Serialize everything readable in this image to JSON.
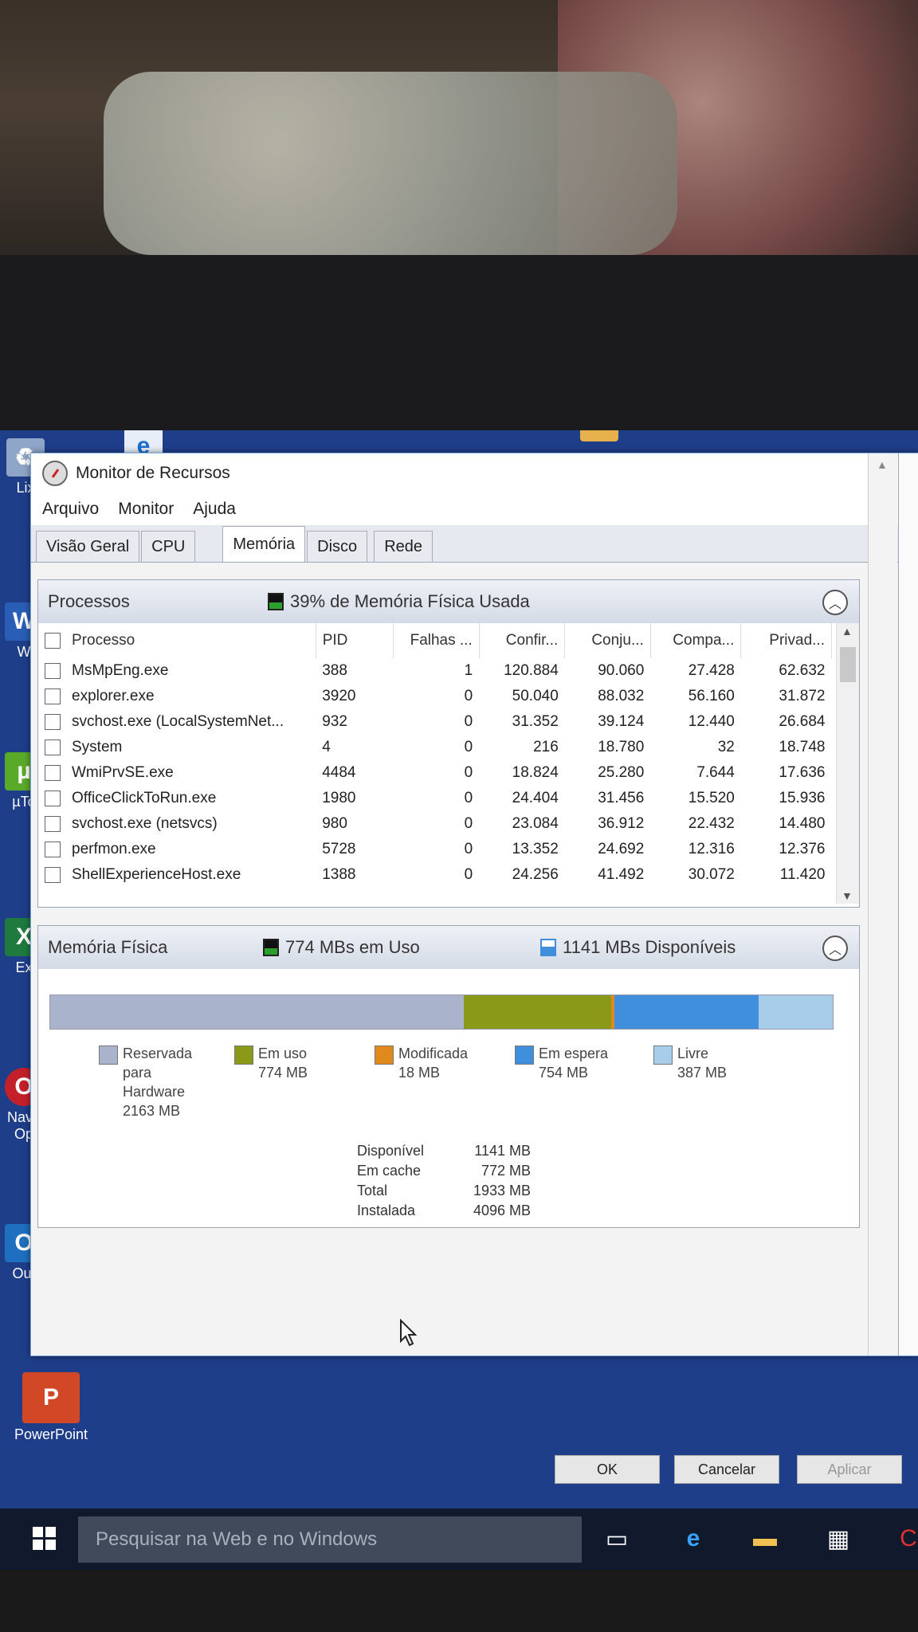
{
  "window": {
    "title": "Monitor de Recursos",
    "menu": [
      "Arquivo",
      "Monitor",
      "Ajuda"
    ],
    "tabs": [
      "Visão Geral",
      "CPU",
      "Memória",
      "Disco",
      "Rede"
    ],
    "active_tab": "Memória"
  },
  "processes": {
    "title": "Processos",
    "usage_text": "39% de Memória Física Usada",
    "columns": [
      "Processo",
      "PID",
      "Falhas ...",
      "Confir...",
      "Conju...",
      "Compa...",
      "Privad..."
    ],
    "rows": [
      [
        "MsMpEng.exe",
        "388",
        "1",
        "120.884",
        "90.060",
        "27.428",
        "62.632"
      ],
      [
        "explorer.exe",
        "3920",
        "0",
        "50.040",
        "88.032",
        "56.160",
        "31.872"
      ],
      [
        "svchost.exe (LocalSystemNet...",
        "932",
        "0",
        "31.352",
        "39.124",
        "12.440",
        "26.684"
      ],
      [
        "System",
        "4",
        "0",
        "216",
        "18.780",
        "32",
        "18.748"
      ],
      [
        "WmiPrvSE.exe",
        "4484",
        "0",
        "18.824",
        "25.280",
        "7.644",
        "17.636"
      ],
      [
        "OfficeClickToRun.exe",
        "1980",
        "0",
        "24.404",
        "31.456",
        "15.520",
        "15.936"
      ],
      [
        "svchost.exe (netsvcs)",
        "980",
        "0",
        "23.084",
        "36.912",
        "22.432",
        "14.480"
      ],
      [
        "perfmon.exe",
        "5728",
        "0",
        "13.352",
        "24.692",
        "12.316",
        "12.376"
      ],
      [
        "ShellExperienceHost.exe",
        "1388",
        "0",
        "24.256",
        "41.492",
        "30.072",
        "11.420"
      ]
    ]
  },
  "memory": {
    "title": "Memória Física",
    "in_use_text": "774 MBs em Uso",
    "available_text": "1141 MBs Disponíveis",
    "segments": [
      {
        "label": "Reservada para Hardware",
        "value": "2163 MB",
        "mb": 2163,
        "color": "#a9b4cc"
      },
      {
        "label": "Em uso",
        "value": "774 MB",
        "mb": 774,
        "color": "#8a9a18"
      },
      {
        "label": "Modificada",
        "value": "18 MB",
        "mb": 18,
        "color": "#e08a1e"
      },
      {
        "label": "Em espera",
        "value": "754 MB",
        "mb": 754,
        "color": "#3f8fdc"
      },
      {
        "label": "Livre",
        "value": "387 MB",
        "mb": 387,
        "color": "#a7cdea"
      }
    ],
    "summary": [
      {
        "label": "Disponível",
        "value": "1141 MB"
      },
      {
        "label": "Em cache",
        "value": "772 MB"
      },
      {
        "label": "Total",
        "value": "1933 MB"
      },
      {
        "label": "Instalada",
        "value": "4096 MB"
      }
    ]
  },
  "dialog": {
    "ok": "OK",
    "cancel": "Cancelar",
    "apply": "Aplicar"
  },
  "taskbar": {
    "search_placeholder": "Pesquisar na Web e no Windows"
  },
  "desktop": {
    "icons": [
      "Lix",
      "W",
      "µTo",
      "Ex",
      "Nave Op",
      "Out",
      "PowerPoint"
    ]
  },
  "colors": {
    "desktop": "#1f3e8a",
    "in_use": "#8a9a18",
    "modified": "#e08a1e",
    "standby": "#3f8fdc",
    "free": "#a7cdea",
    "hardware": "#a9b4cc",
    "taskbar": "#101a2c"
  }
}
